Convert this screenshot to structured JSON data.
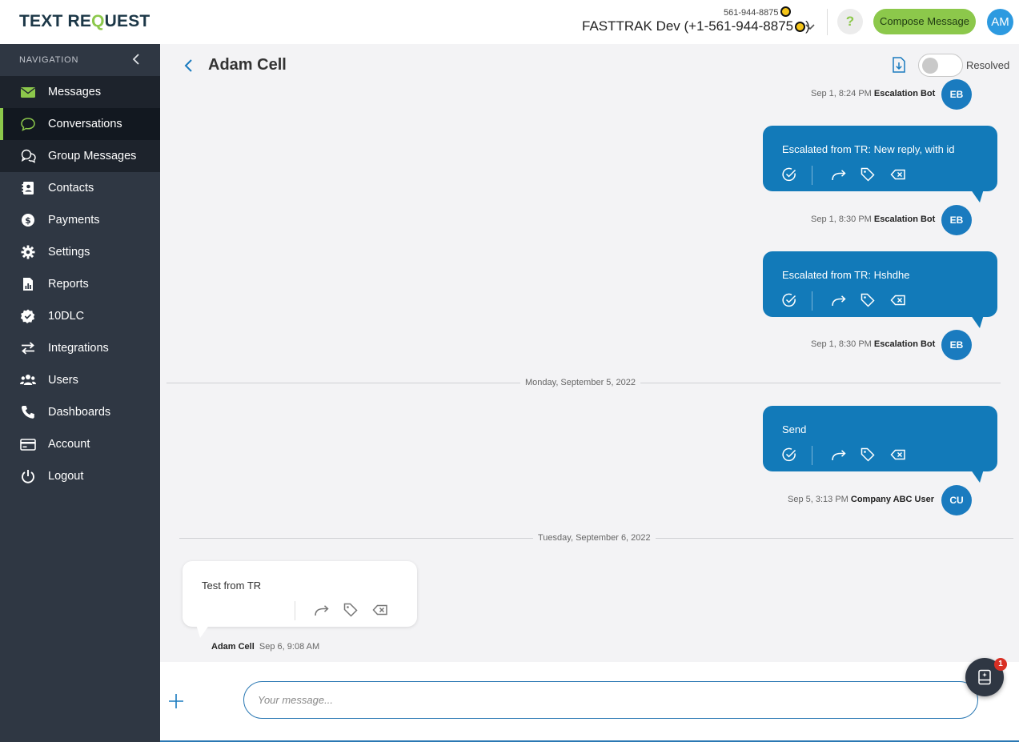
{
  "brand": {
    "logo_part1": "TEXT RE",
    "logo_q": "Q",
    "logo_part2": "UEST"
  },
  "account": {
    "phone_small": "561-944-8875",
    "name": "FASTTRAK Dev (+1-561-944-8875",
    "suffix": ")"
  },
  "header": {
    "help_label": "?",
    "compose_label": "Compose Message",
    "user_initials": "AM"
  },
  "nav": {
    "heading": "NAVIGATION",
    "items": [
      {
        "label": "Messages",
        "icon": "envelope-icon"
      },
      {
        "label": "Conversations",
        "icon": "chat-bubble-icon"
      },
      {
        "label": "Group Messages",
        "icon": "group-chat-icon"
      },
      {
        "label": "Contacts",
        "icon": "contact-card-icon"
      },
      {
        "label": "Payments",
        "icon": "dollar-icon"
      },
      {
        "label": "Settings",
        "icon": "gear-icon"
      },
      {
        "label": "Reports",
        "icon": "report-icon"
      },
      {
        "label": "10DLC",
        "icon": "badge-check-icon"
      },
      {
        "label": "Integrations",
        "icon": "arrows-swap-icon"
      },
      {
        "label": "Users",
        "icon": "users-icon"
      },
      {
        "label": "Dashboards",
        "icon": "phone-icon"
      },
      {
        "label": "Account",
        "icon": "credit-card-icon"
      },
      {
        "label": "Logout",
        "icon": "power-icon"
      }
    ]
  },
  "conversation": {
    "contact_name": "Adam Cell",
    "resolved_label": "Resolved",
    "resolved": false,
    "messages": [
      {
        "time": "Sep 1, 8:24 PM",
        "sender": "Escalation Bot",
        "initials": "EB"
      },
      {
        "text": "Escalated from TR: New reply, with id",
        "time": "Sep 1, 8:30 PM",
        "sender": "Escalation Bot",
        "initials": "EB"
      },
      {
        "text": "Escalated from TR: Hshdhe",
        "time": "Sep 1, 8:30 PM",
        "sender": "Escalation Bot",
        "initials": "EB"
      },
      {
        "text": "Send",
        "time": "Sep 5, 3:13 PM",
        "sender": "Company ABC User",
        "initials": "CU"
      },
      {
        "text": "Test from TR",
        "time": "Sep 6, 9:08 AM",
        "sender": "Adam Cell"
      }
    ],
    "date_dividers": [
      "Monday, September 5, 2022",
      "Tuesday, September 6, 2022"
    ]
  },
  "composer": {
    "placeholder": "Your message...",
    "value": ""
  },
  "notifications": {
    "count": "1"
  },
  "colors": {
    "accent_green": "#8cc84b",
    "bubble_blue": "#127ab9",
    "sidebar": "#2f3743",
    "avatar_blue": "#1a7bbf"
  }
}
